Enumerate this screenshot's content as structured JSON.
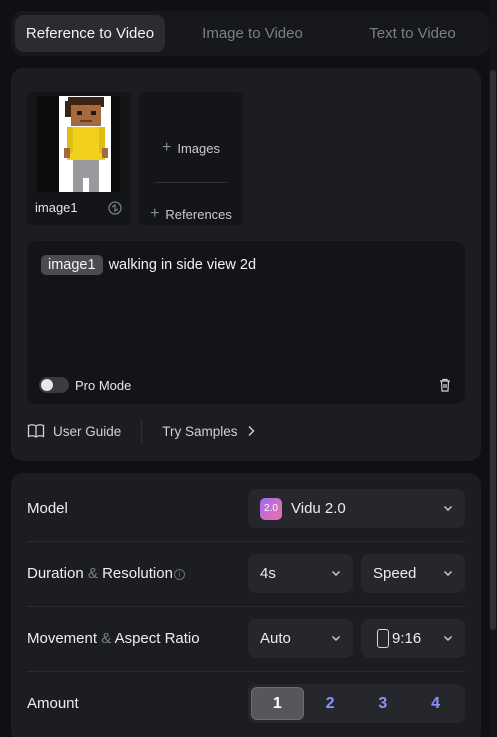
{
  "tabs": [
    {
      "label": "Reference to Video",
      "active": true
    },
    {
      "label": "Image to Video",
      "active": false
    },
    {
      "label": "Text to Video",
      "active": false
    }
  ],
  "references": {
    "thumbnail_label": "image1",
    "add_images_label": "Images",
    "add_references_label": "References"
  },
  "prompt": {
    "chip": "image1",
    "text": "walking in side view 2d",
    "pro_mode_label": "Pro Mode",
    "pro_mode_on": false
  },
  "links": {
    "user_guide": "User Guide",
    "try_samples": "Try Samples"
  },
  "settings": {
    "model_label": "Model",
    "model_value": "Vidu 2.0",
    "model_logo_text": "2.0",
    "duration_label_a": "Duration",
    "duration_label_b": "Resolution",
    "duration_value": "4s",
    "resolution_value": "Speed",
    "movement_label_a": "Movement",
    "movement_label_b": "Aspect Ratio",
    "movement_value": "Auto",
    "aspect_value": "9:16",
    "amp": "&",
    "amount_label": "Amount",
    "amount_options": [
      "1",
      "2",
      "3",
      "4"
    ],
    "amount_selected": "1"
  },
  "colors": {
    "accent_number": "#8a94ff",
    "background": "#0f1013",
    "card": "#1c1d21"
  }
}
